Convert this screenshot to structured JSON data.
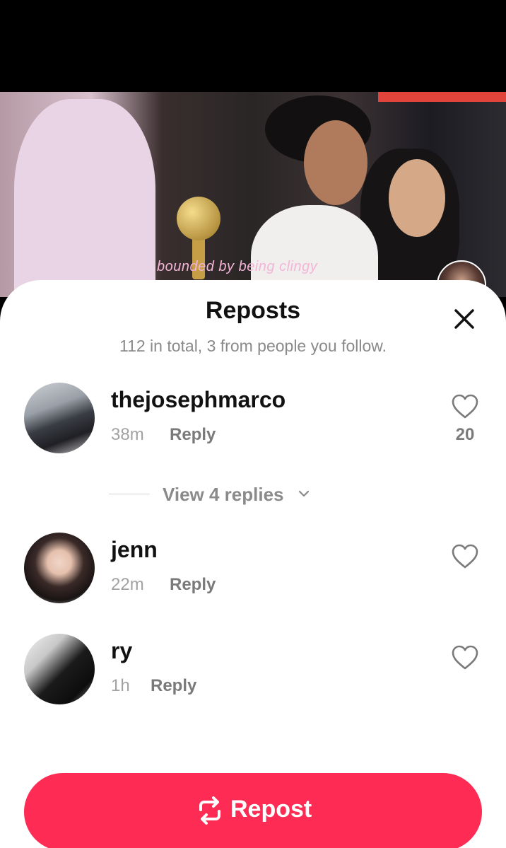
{
  "video": {
    "caption": "bounded by being clingy"
  },
  "sheet": {
    "title": "Reposts",
    "subtitle": "112 in total, 3 from people you follow."
  },
  "reposts": [
    {
      "username": "thejosephmarco",
      "time": "38m",
      "reply_label": "Reply",
      "likes": "20"
    },
    {
      "username": "jenn",
      "time": "22m",
      "reply_label": "Reply",
      "likes": ""
    },
    {
      "username": "ry",
      "time": "1h",
      "reply_label": "Reply",
      "likes": ""
    }
  ],
  "view_replies_label": "View 4 replies",
  "repost_button_label": "Repost",
  "colors": {
    "accent": "#fe2c55",
    "muted_text": "#8a8a8a"
  },
  "icons": {
    "close": "close-icon",
    "heart": "heart-outline-icon",
    "chevron": "chevron-down-icon",
    "repost": "repost-icon"
  }
}
